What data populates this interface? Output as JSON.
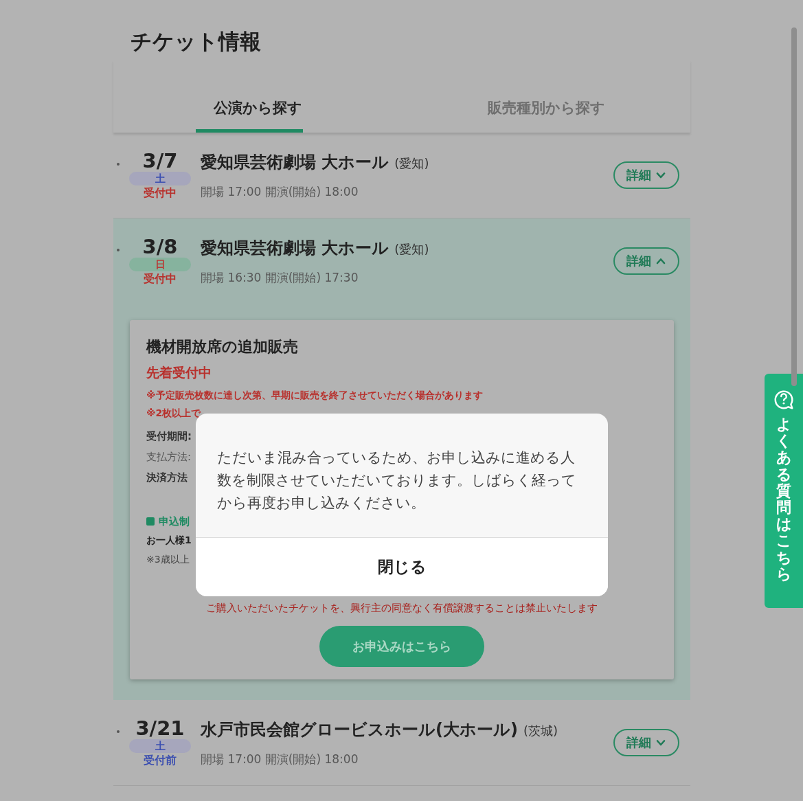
{
  "page_title": "チケット情報",
  "tabs": [
    {
      "label": "公演から探す",
      "selected": true
    },
    {
      "label": "販売種別から探す",
      "selected": false
    }
  ],
  "events": [
    {
      "date": "3/7",
      "weekday": {
        "text": "土",
        "color": "#3c4fb0"
      },
      "status": {
        "text": "受付中",
        "color": "#b8302c"
      },
      "venue": "愛知県芸術劇場 大ホール",
      "prefecture": "(愛知)",
      "times": "開場 17:00 開演(開始) 18:00",
      "detail_button": "詳細",
      "expanded": false
    },
    {
      "date": "3/8",
      "weekday": {
        "text": "日",
        "color": "#b83a36"
      },
      "status": {
        "text": "受付中",
        "color": "#b8302c"
      },
      "venue": "愛知県芸術劇場 大ホール",
      "prefecture": "(愛知)",
      "times": "開場 16:30 開演(開始) 17:30",
      "detail_button": "詳細",
      "expanded": true,
      "sale": {
        "title": "機材開放席の追加販売",
        "status": "先着受付中",
        "notes": [
          "※予定販売枚数に達し次第、早期に販売を終了させていただく場合があります",
          "※2枚以上で"
        ],
        "fields": [
          {
            "text": "受付期間:",
            "kind": "bold"
          },
          {
            "text": "支払方法:",
            "kind": "plain"
          },
          {
            "text": "決済方法",
            "kind": "bold"
          }
        ],
        "limit": {
          "heading": "申込制",
          "lines": [
            {
              "text": "お一人様1",
              "kind": "bold"
            },
            {
              "text": "※3歳以上",
              "kind": "small"
            }
          ]
        },
        "notice": "ご購入いただいたチケットを、興行主の同意なく有償譲渡することは禁止いたします",
        "apply_button": "お申込みはこちら"
      }
    },
    {
      "date": "3/21",
      "weekday": {
        "text": "土",
        "color": "#3c4fb0"
      },
      "status": {
        "text": "受付前",
        "color": "#3c4fb0"
      },
      "venue": "水戸市民会館グロービスホール(大ホール)",
      "prefecture": "(茨城)",
      "times": "開場 17:00 開演(開始) 18:00",
      "detail_button": "詳細",
      "expanded": false
    }
  ],
  "modal": {
    "message": "ただいま混み合っているため、お申し込みに進める人数を制限させていただいております。しばらく経ってから再度お申し込みください。",
    "close_button": "閉じる"
  },
  "faq_tab": {
    "label": "よくある質問はこちら"
  }
}
